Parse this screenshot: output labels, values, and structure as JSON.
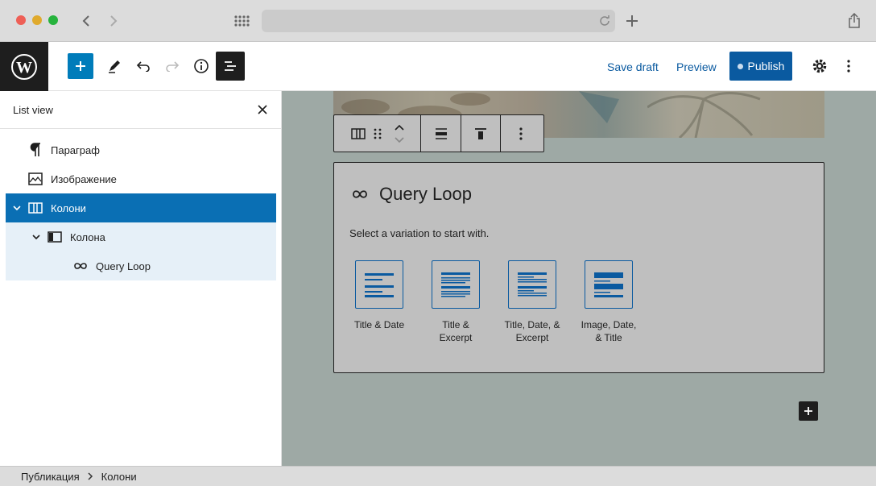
{
  "sidebar": {
    "title": "List view",
    "items": [
      {
        "label": "Параграф",
        "icon": "paragraph-icon"
      },
      {
        "label": "Изображение",
        "icon": "image-icon"
      },
      {
        "label": "Колони",
        "icon": "columns-icon"
      },
      {
        "label": "Колона",
        "icon": "column-icon"
      },
      {
        "label": "Query Loop",
        "icon": "loop-icon"
      }
    ]
  },
  "toolbar": {
    "save_draft": "Save draft",
    "preview": "Preview",
    "publish": "Publish"
  },
  "query_loop": {
    "title": "Query Loop",
    "description": "Select a variation to start with.",
    "variations": [
      {
        "line1": "Title & Date",
        "line2": ""
      },
      {
        "line1": "Title &",
        "line2": "Excerpt"
      },
      {
        "line1": "Title, Date, &",
        "line2": "Excerpt"
      },
      {
        "line1": "Image, Date,",
        "line2": "& Title"
      }
    ]
  },
  "breadcrumb": {
    "items": [
      "Публикация",
      "Колони"
    ]
  },
  "colors": {
    "accent": "#0a5aa0",
    "selected_row": "#0a6fb4",
    "canvas_bg": "#9ea9a5"
  }
}
